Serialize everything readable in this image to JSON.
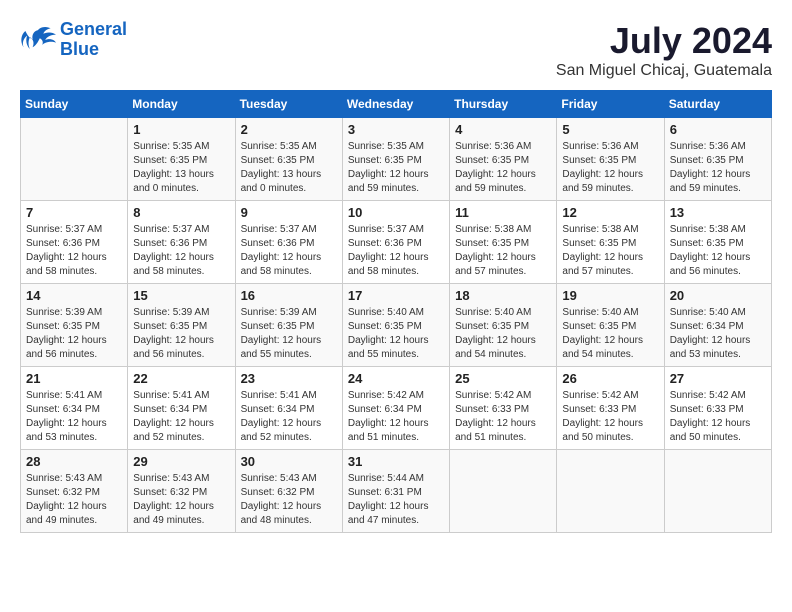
{
  "header": {
    "logo_line1": "General",
    "logo_line2": "Blue",
    "month_year": "July 2024",
    "location": "San Miguel Chicaj, Guatemala"
  },
  "days_of_week": [
    "Sunday",
    "Monday",
    "Tuesday",
    "Wednesday",
    "Thursday",
    "Friday",
    "Saturday"
  ],
  "weeks": [
    [
      {
        "day": "",
        "info": ""
      },
      {
        "day": "1",
        "info": "Sunrise: 5:35 AM\nSunset: 6:35 PM\nDaylight: 13 hours\nand 0 minutes."
      },
      {
        "day": "2",
        "info": "Sunrise: 5:35 AM\nSunset: 6:35 PM\nDaylight: 13 hours\nand 0 minutes."
      },
      {
        "day": "3",
        "info": "Sunrise: 5:35 AM\nSunset: 6:35 PM\nDaylight: 12 hours\nand 59 minutes."
      },
      {
        "day": "4",
        "info": "Sunrise: 5:36 AM\nSunset: 6:35 PM\nDaylight: 12 hours\nand 59 minutes."
      },
      {
        "day": "5",
        "info": "Sunrise: 5:36 AM\nSunset: 6:35 PM\nDaylight: 12 hours\nand 59 minutes."
      },
      {
        "day": "6",
        "info": "Sunrise: 5:36 AM\nSunset: 6:35 PM\nDaylight: 12 hours\nand 59 minutes."
      }
    ],
    [
      {
        "day": "7",
        "info": "Sunrise: 5:37 AM\nSunset: 6:36 PM\nDaylight: 12 hours\nand 58 minutes."
      },
      {
        "day": "8",
        "info": "Sunrise: 5:37 AM\nSunset: 6:36 PM\nDaylight: 12 hours\nand 58 minutes."
      },
      {
        "day": "9",
        "info": "Sunrise: 5:37 AM\nSunset: 6:36 PM\nDaylight: 12 hours\nand 58 minutes."
      },
      {
        "day": "10",
        "info": "Sunrise: 5:37 AM\nSunset: 6:36 PM\nDaylight: 12 hours\nand 58 minutes."
      },
      {
        "day": "11",
        "info": "Sunrise: 5:38 AM\nSunset: 6:35 PM\nDaylight: 12 hours\nand 57 minutes."
      },
      {
        "day": "12",
        "info": "Sunrise: 5:38 AM\nSunset: 6:35 PM\nDaylight: 12 hours\nand 57 minutes."
      },
      {
        "day": "13",
        "info": "Sunrise: 5:38 AM\nSunset: 6:35 PM\nDaylight: 12 hours\nand 56 minutes."
      }
    ],
    [
      {
        "day": "14",
        "info": "Sunrise: 5:39 AM\nSunset: 6:35 PM\nDaylight: 12 hours\nand 56 minutes."
      },
      {
        "day": "15",
        "info": "Sunrise: 5:39 AM\nSunset: 6:35 PM\nDaylight: 12 hours\nand 56 minutes."
      },
      {
        "day": "16",
        "info": "Sunrise: 5:39 AM\nSunset: 6:35 PM\nDaylight: 12 hours\nand 55 minutes."
      },
      {
        "day": "17",
        "info": "Sunrise: 5:40 AM\nSunset: 6:35 PM\nDaylight: 12 hours\nand 55 minutes."
      },
      {
        "day": "18",
        "info": "Sunrise: 5:40 AM\nSunset: 6:35 PM\nDaylight: 12 hours\nand 54 minutes."
      },
      {
        "day": "19",
        "info": "Sunrise: 5:40 AM\nSunset: 6:35 PM\nDaylight: 12 hours\nand 54 minutes."
      },
      {
        "day": "20",
        "info": "Sunrise: 5:40 AM\nSunset: 6:34 PM\nDaylight: 12 hours\nand 53 minutes."
      }
    ],
    [
      {
        "day": "21",
        "info": "Sunrise: 5:41 AM\nSunset: 6:34 PM\nDaylight: 12 hours\nand 53 minutes."
      },
      {
        "day": "22",
        "info": "Sunrise: 5:41 AM\nSunset: 6:34 PM\nDaylight: 12 hours\nand 52 minutes."
      },
      {
        "day": "23",
        "info": "Sunrise: 5:41 AM\nSunset: 6:34 PM\nDaylight: 12 hours\nand 52 minutes."
      },
      {
        "day": "24",
        "info": "Sunrise: 5:42 AM\nSunset: 6:34 PM\nDaylight: 12 hours\nand 51 minutes."
      },
      {
        "day": "25",
        "info": "Sunrise: 5:42 AM\nSunset: 6:33 PM\nDaylight: 12 hours\nand 51 minutes."
      },
      {
        "day": "26",
        "info": "Sunrise: 5:42 AM\nSunset: 6:33 PM\nDaylight: 12 hours\nand 50 minutes."
      },
      {
        "day": "27",
        "info": "Sunrise: 5:42 AM\nSunset: 6:33 PM\nDaylight: 12 hours\nand 50 minutes."
      }
    ],
    [
      {
        "day": "28",
        "info": "Sunrise: 5:43 AM\nSunset: 6:32 PM\nDaylight: 12 hours\nand 49 minutes."
      },
      {
        "day": "29",
        "info": "Sunrise: 5:43 AM\nSunset: 6:32 PM\nDaylight: 12 hours\nand 49 minutes."
      },
      {
        "day": "30",
        "info": "Sunrise: 5:43 AM\nSunset: 6:32 PM\nDaylight: 12 hours\nand 48 minutes."
      },
      {
        "day": "31",
        "info": "Sunrise: 5:44 AM\nSunset: 6:31 PM\nDaylight: 12 hours\nand 47 minutes."
      },
      {
        "day": "",
        "info": ""
      },
      {
        "day": "",
        "info": ""
      },
      {
        "day": "",
        "info": ""
      }
    ]
  ]
}
